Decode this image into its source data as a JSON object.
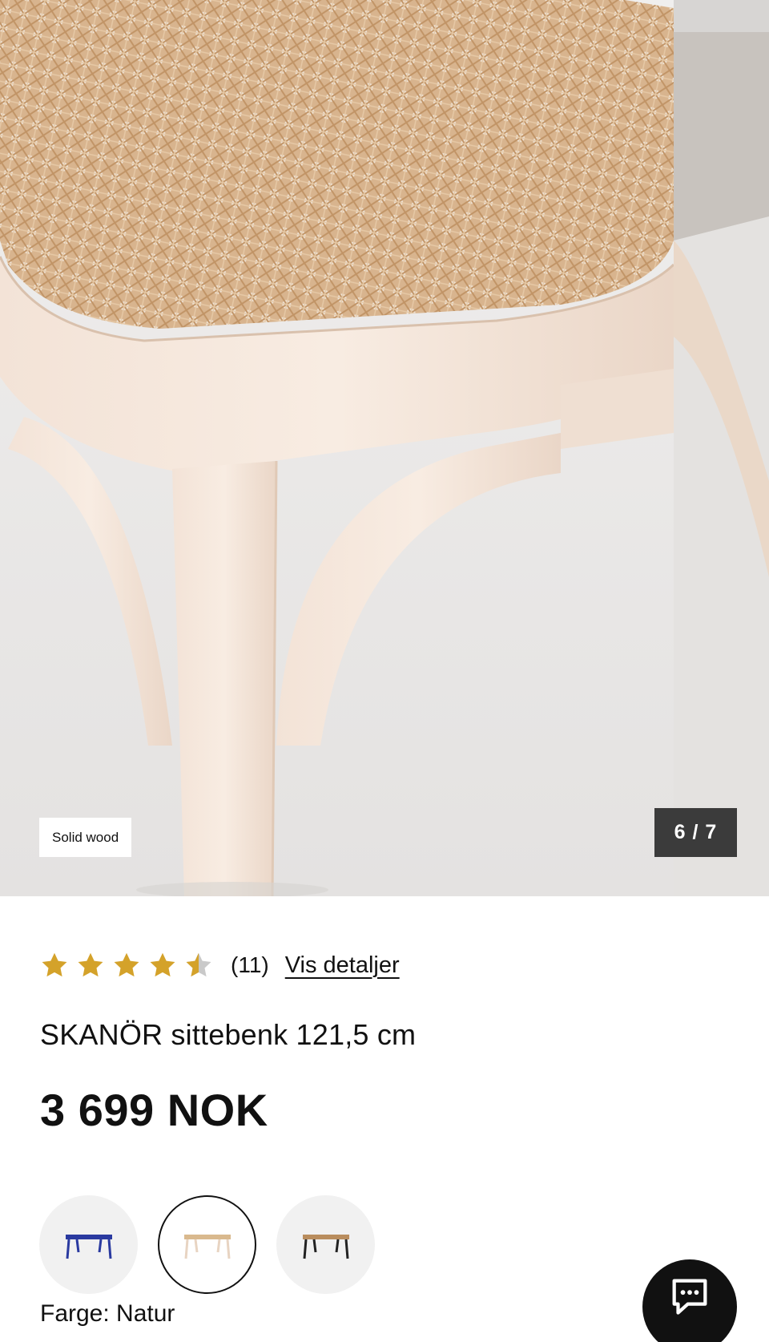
{
  "gallery": {
    "badge": "Solid wood",
    "counter": "6 / 7",
    "image_alt": "Rattan seat and wooden legs close-up"
  },
  "rating": {
    "value": 4.5,
    "max": 5,
    "star_color": "#d4a22a",
    "review_count": "(11)",
    "details_link": "Vis detaljer"
  },
  "product": {
    "title": "SKANÖR sittebenk 121,5 cm",
    "price": "3 699 NOK"
  },
  "colors": {
    "options": [
      {
        "name": "blue-bench",
        "frame_color": "#2a3aa0",
        "seat_color": "#2a3aa0"
      },
      {
        "name": "natural-bench",
        "frame_color": "#e8d4c2",
        "seat_color": "#d9b98e"
      },
      {
        "name": "black-bench",
        "frame_color": "#222222",
        "seat_color": "#b98d5e"
      }
    ],
    "selected_index": 1,
    "label": "Farge: Natur"
  }
}
